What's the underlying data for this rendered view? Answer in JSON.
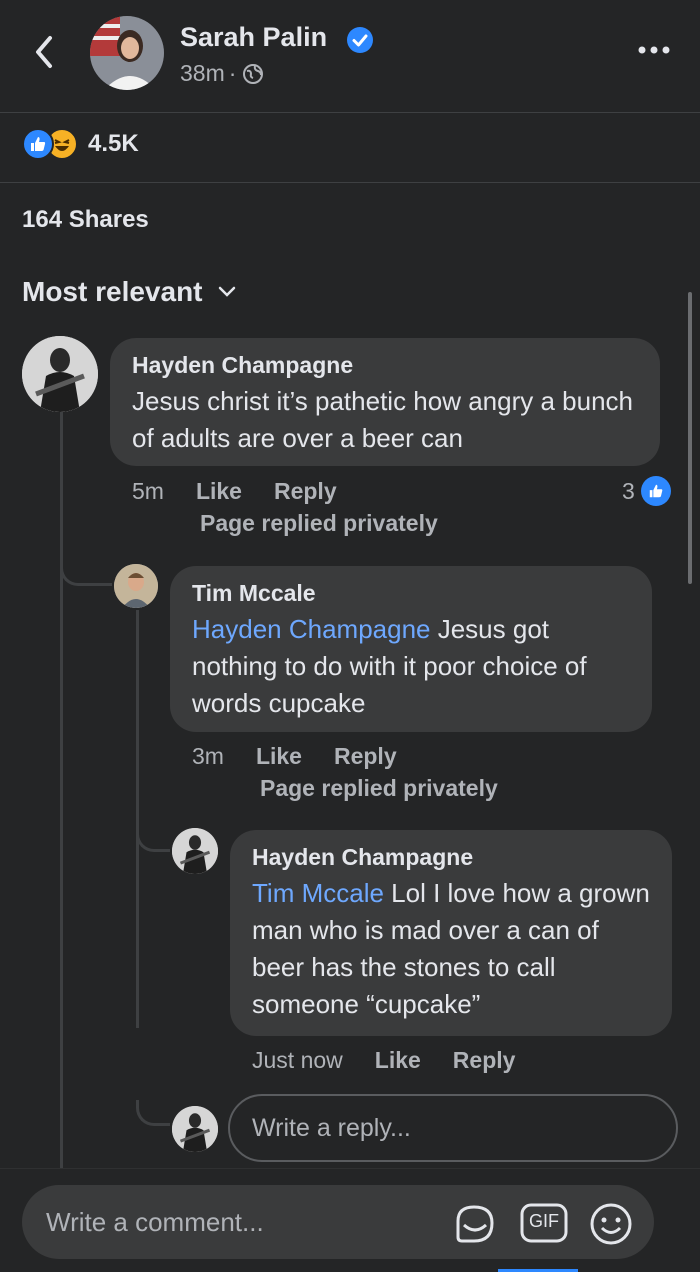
{
  "header": {
    "author": "Sarah Palin",
    "time": "38m",
    "separator": "·"
  },
  "reactions": {
    "count": "4.5K",
    "types": [
      "like",
      "haha"
    ]
  },
  "shares": "164 Shares",
  "sort": {
    "label": "Most relevant"
  },
  "comments": [
    {
      "author": "Hayden Champagne",
      "text": "Jesus christ it’s pathetic how angry a bunch of adults are over a beer can",
      "time": "5m",
      "like_label": "Like",
      "reply_label": "Reply",
      "status": "Page replied privately",
      "like_count": "3"
    },
    {
      "author": "Tim Mccale",
      "mention": "Hayden Champagne",
      "text": " Jesus got nothing to do with it poor choice of words cupcake",
      "time": "3m",
      "like_label": "Like",
      "reply_label": "Reply",
      "status": "Page replied privately"
    },
    {
      "author": "Hayden Champagne",
      "mention": "Tim Mccale",
      "text": " Lol I love how a grown man who is mad over a can of beer has the stones to call someone “cupcake”",
      "time": "Just now",
      "like_label": "Like",
      "reply_label": "Reply"
    }
  ],
  "reply_box": {
    "placeholder": "Write a reply..."
  },
  "composer": {
    "placeholder": "Write a comment...",
    "gif_label": "GIF"
  },
  "colors": {
    "accent": "#2d88ff",
    "mention": "#6ea8fe",
    "background": "#242526",
    "bubble": "#3a3b3c"
  }
}
